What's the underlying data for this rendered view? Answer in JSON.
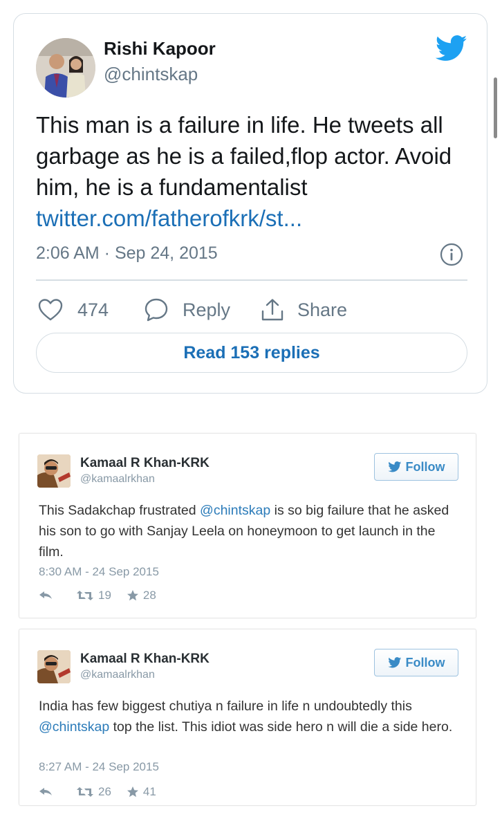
{
  "main_tweet": {
    "author_name": "Rishi Kapoor",
    "author_handle": "@chintskap",
    "text": "This man is a failure in life. He tweets all garbage as he is a failed,flop actor. Avoid him, he is a fundamentalist",
    "link": "twitter.com/fatherofkrk/st...",
    "timestamp": "2:06 AM · Sep 24, 2015",
    "likes": "474",
    "reply_label": "Reply",
    "share_label": "Share",
    "read_replies_label": "Read 153 replies",
    "icons": [
      "twitter-bird-icon",
      "info-icon",
      "heart-icon",
      "reply-bubble-icon",
      "share-icon"
    ],
    "colors": {
      "link": "#1b6fb6",
      "bird": "#1da1f2",
      "muted": "#657786"
    }
  },
  "embedded_tweets": [
    {
      "author_name": "Kamaal R Khan-KRK",
      "author_handle": "@kamaalrkhan",
      "follow_label": "Follow",
      "text_before": "This Sadakchap frustrated ",
      "mention": "@chintskap",
      "text_after": " is so big failure that he asked his son to go with Sanjay Leela on honeymoon to get launch in the film.",
      "timestamp": "8:30 AM - 24 Sep 2015",
      "retweets": "19",
      "favorites": "28"
    },
    {
      "author_name": "Kamaal R Khan-KRK",
      "author_handle": "@kamaalrkhan",
      "follow_label": "Follow",
      "text_before": "India has few biggest chutiya n failure in life n undoubtedly this ",
      "mention": "@chintskap",
      "text_after": " top the list. This idiot was side hero n will die a side hero.",
      "timestamp": "8:27 AM - 24 Sep 2015",
      "retweets": "26",
      "favorites": "41"
    }
  ]
}
